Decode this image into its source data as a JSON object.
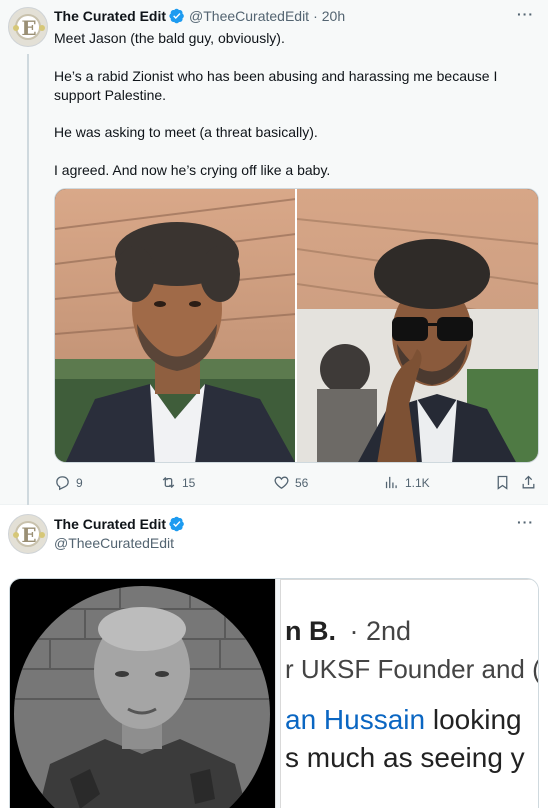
{
  "tweet1": {
    "author_name": "The Curated Edit",
    "handle": "@TheeCuratedEdit",
    "separator": "·",
    "time": "20h",
    "more": "···",
    "paragraphs": [
      "Meet Jason (the bald guy, obviously).",
      "He’s a rabid Zionist who has been abusing and harassing me because I support Palestine.",
      "He was asking to meet (a threat basically).",
      "I agreed. And now he’s crying off like a baby."
    ],
    "actions": {
      "replies": "9",
      "reposts": "15",
      "likes": "56",
      "views": "1.1K"
    }
  },
  "tweet2": {
    "author_name": "The Curated Edit",
    "handle": "@TheeCuratedEdit",
    "more": "···",
    "screenshot": {
      "line1": "n B.",
      "line1_degree": "· 2nd",
      "line2": "r UKSF Founder and (",
      "line3_blue": "an Hussain",
      "line3_rest": " looking",
      "line4": "s much as seeing y"
    }
  },
  "colors": {
    "verified_blue": "#1d9bf0",
    "muted": "#536471",
    "text": "#0f1419",
    "thread_bg": "#f7f9f9",
    "link_blue": "#0a66c2"
  },
  "icons": [
    "verified-badge-icon",
    "more-icon",
    "reply-icon",
    "repost-icon",
    "like-icon",
    "views-icon",
    "bookmark-icon",
    "share-icon"
  ]
}
